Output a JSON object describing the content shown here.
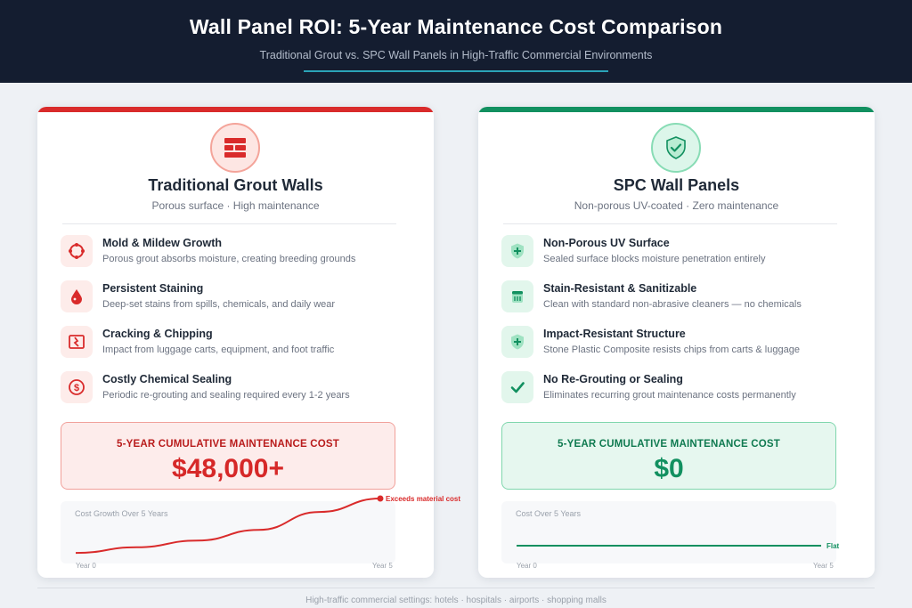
{
  "header": {
    "title": "Wall Panel ROI: 5-Year Maintenance Cost Comparison",
    "subtitle": "Traditional Grout vs. SPC Wall Panels in High-Traffic Commercial Environments"
  },
  "left": {
    "badge_icon": "brick-wall-icon",
    "title": "Traditional Grout Walls",
    "tagline": "Porous surface · High maintenance",
    "accent": "#d92b2b",
    "features": [
      {
        "icon": "mold-icon",
        "title": "Mold & Mildew Growth",
        "desc": "Porous grout absorbs moisture, creating breeding grounds"
      },
      {
        "icon": "droplet-icon",
        "title": "Persistent Staining",
        "desc": "Deep-set stains from spills, chemicals, and daily wear"
      },
      {
        "icon": "crack-icon",
        "title": "Cracking & Chipping",
        "desc": "Impact from luggage carts, equipment, and foot traffic"
      },
      {
        "icon": "dollar-icon",
        "title": "Costly Chemical Sealing",
        "desc": "Periodic re-grouting and sealing required every 1-2 years"
      }
    ],
    "cost_label": "5-YEAR CUMULATIVE MAINTENANCE COST",
    "cost_value": "$48,000+",
    "chart_title": "Cost Growth Over 5 Years",
    "chart_annotation": "Exceeds material cost",
    "x_start": "Year 0",
    "x_end": "Year 5"
  },
  "right": {
    "badge_icon": "shield-check-icon",
    "title": "SPC Wall Panels",
    "tagline": "Non-porous UV-coated · Zero maintenance",
    "accent": "#129060",
    "features": [
      {
        "icon": "shield-plus-icon",
        "title": "Non-Porous UV Surface",
        "desc": "Sealed surface blocks moisture penetration entirely"
      },
      {
        "icon": "sanitize-icon",
        "title": "Stain-Resistant & Sanitizable",
        "desc": "Clean with standard non-abrasive cleaners — no chemicals"
      },
      {
        "icon": "shield-plus-icon",
        "title": "Impact-Resistant Structure",
        "desc": "Stone Plastic Composite resists chips from carts & luggage"
      },
      {
        "icon": "check-icon",
        "title": "No Re-Grouting or Sealing",
        "desc": "Eliminates recurring grout maintenance costs permanently"
      }
    ],
    "cost_label": "5-YEAR CUMULATIVE MAINTENANCE COST",
    "cost_value": "$0",
    "chart_title": "Cost Over 5 Years",
    "chart_annotation": "Flat",
    "x_start": "Year 0",
    "x_end": "Year 5"
  },
  "chart_data": [
    {
      "type": "line",
      "title": "Cost Growth Over 5 Years",
      "x": [
        0,
        1,
        2,
        3,
        4,
        5
      ],
      "series": [
        {
          "values": [
            0.03,
            0.13,
            0.25,
            0.44,
            0.76,
            1.0
          ]
        }
      ],
      "annotations": [
        "Exceeds material cost"
      ],
      "xlabels": [
        "Year 0",
        "Year 5"
      ],
      "color": "#d92b2b"
    },
    {
      "type": "line",
      "title": "Cost Over 5 Years",
      "x": [
        0,
        1,
        2,
        3,
        4,
        5
      ],
      "series": [
        {
          "values": [
            0,
            0,
            0,
            0,
            0,
            0
          ]
        }
      ],
      "annotations": [
        "Flat"
      ],
      "xlabels": [
        "Year 0",
        "Year 5"
      ],
      "color": "#129060"
    }
  ],
  "footer": "High-traffic commercial settings: hotels · hospitals · airports · shopping malls"
}
